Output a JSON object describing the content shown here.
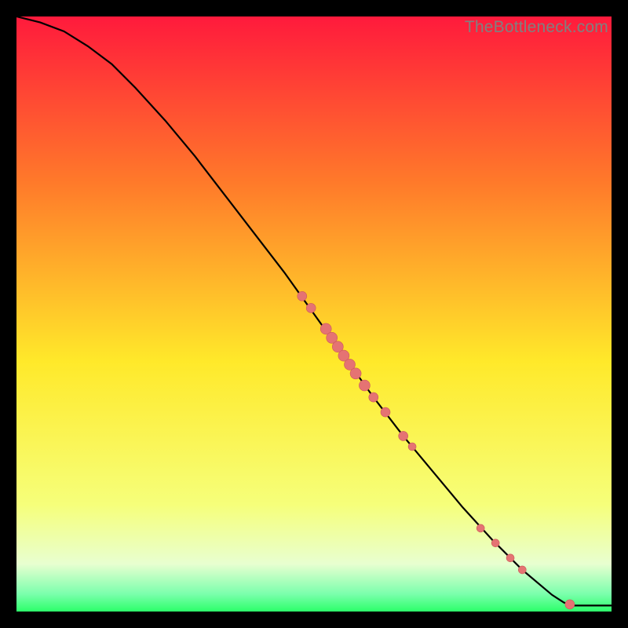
{
  "watermark": "TheBottleneck.com",
  "colors": {
    "gradient_top": "#ff1a3c",
    "gradient_mid1": "#ff7a2a",
    "gradient_mid2": "#ffe92a",
    "gradient_mid3": "#f6ff7a",
    "gradient_bottom_light": "#e8ffd0",
    "gradient_green": "#2cff6a",
    "curve": "#000000",
    "point_fill": "#e57373",
    "point_stroke": "#cc5a5a"
  },
  "chart_data": {
    "type": "line",
    "title": "",
    "xlabel": "",
    "ylabel": "",
    "xlim": [
      0,
      100
    ],
    "ylim": [
      0,
      100
    ],
    "curve": [
      {
        "x": 0,
        "y": 100
      },
      {
        "x": 4,
        "y": 99.0
      },
      {
        "x": 8,
        "y": 97.5
      },
      {
        "x": 12,
        "y": 95.0
      },
      {
        "x": 16,
        "y": 92.0
      },
      {
        "x": 20,
        "y": 88.0
      },
      {
        "x": 25,
        "y": 82.5
      },
      {
        "x": 30,
        "y": 76.5
      },
      {
        "x": 35,
        "y": 70.0
      },
      {
        "x": 40,
        "y": 63.5
      },
      {
        "x": 45,
        "y": 57.0
      },
      {
        "x": 50,
        "y": 50.0
      },
      {
        "x": 55,
        "y": 43.0
      },
      {
        "x": 60,
        "y": 36.0
      },
      {
        "x": 65,
        "y": 29.5
      },
      {
        "x": 70,
        "y": 23.5
      },
      {
        "x": 75,
        "y": 17.5
      },
      {
        "x": 80,
        "y": 12.0
      },
      {
        "x": 85,
        "y": 7.0
      },
      {
        "x": 90,
        "y": 2.8
      },
      {
        "x": 92,
        "y": 1.5
      },
      {
        "x": 93.5,
        "y": 1.0
      },
      {
        "x": 100,
        "y": 1.0
      }
    ],
    "points": [
      {
        "x": 48.0,
        "y": 53.0,
        "r": 6
      },
      {
        "x": 49.5,
        "y": 51.0,
        "r": 6
      },
      {
        "x": 52.0,
        "y": 47.5,
        "r": 7
      },
      {
        "x": 53.0,
        "y": 46.0,
        "r": 7
      },
      {
        "x": 54.0,
        "y": 44.5,
        "r": 7
      },
      {
        "x": 55.0,
        "y": 43.0,
        "r": 7
      },
      {
        "x": 56.0,
        "y": 41.5,
        "r": 7
      },
      {
        "x": 57.0,
        "y": 40.0,
        "r": 7
      },
      {
        "x": 58.5,
        "y": 38.0,
        "r": 7
      },
      {
        "x": 60.0,
        "y": 36.0,
        "r": 6
      },
      {
        "x": 62.0,
        "y": 33.5,
        "r": 6
      },
      {
        "x": 65.0,
        "y": 29.5,
        "r": 6
      },
      {
        "x": 66.5,
        "y": 27.7,
        "r": 5
      },
      {
        "x": 78.0,
        "y": 14.0,
        "r": 5
      },
      {
        "x": 80.5,
        "y": 11.5,
        "r": 5
      },
      {
        "x": 83.0,
        "y": 9.0,
        "r": 5
      },
      {
        "x": 85.0,
        "y": 7.0,
        "r": 5
      },
      {
        "x": 93.0,
        "y": 1.2,
        "r": 6
      }
    ]
  }
}
